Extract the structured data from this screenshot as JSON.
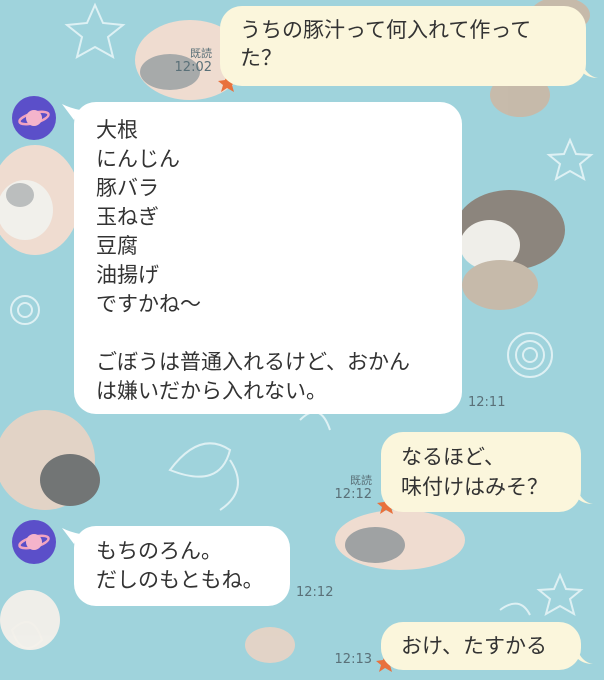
{
  "messages": [
    {
      "from": "me",
      "text": "うちの豚汁って何入れて作ってた？",
      "read": "既読",
      "time": "12:02"
    },
    {
      "from": "other",
      "text": "大根\nにんじん\n豚バラ\n玉ねぎ\n豆腐\n油揚げ\nですかね〜\n\nごぼうは普通入れるけど、おかん\nは嫌いだから入れない。",
      "time": "12:11"
    },
    {
      "from": "me",
      "text": "なるほど、\n味付けはみそ？",
      "read": "既読",
      "time": "12:12"
    },
    {
      "from": "other",
      "text": "もちのろん。\nだしのもともね。",
      "time": "12:12"
    },
    {
      "from": "me",
      "text": "おけ、たすかる",
      "time": "12:13"
    }
  ],
  "colors": {
    "background": "#9fd3dc",
    "bubble_in": "#ffffff",
    "bubble_out": "#fbf6dc",
    "avatar": "#5b4fc9"
  },
  "icons": [
    "saturn-avatar-icon"
  ]
}
